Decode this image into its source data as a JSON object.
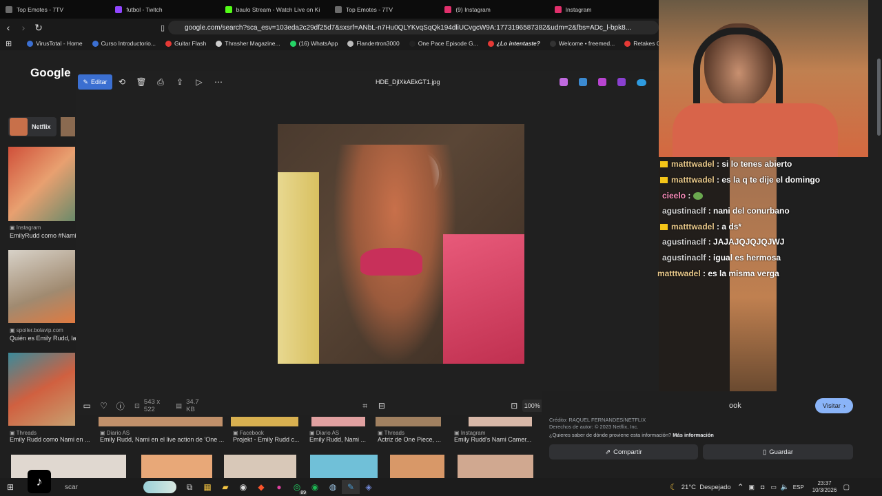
{
  "tabs": [
    {
      "label": "Top Emotes - 7TV",
      "color": "#6b6b6b"
    },
    {
      "label": "futbol - Twitch",
      "color": "#9146ff"
    },
    {
      "label": "baulo Stream - Watch Live on Ki",
      "color": "#53fc18"
    },
    {
      "label": "Top Emotes - 7TV",
      "color": "#6b6b6b"
    },
    {
      "label": "(9) Instagram",
      "color": "#e1306c"
    },
    {
      "label": "Instagram",
      "color": "#e1306c"
    }
  ],
  "omnibox": {
    "url": "google.com/search?sca_esv=103eda2c29df25d7&sxsrf=ANbL-n7Hu0QLYKvqSqQk194dliUCvgcW9A:1773196587382&udm=2&fbs=ADc_l-bpk8..."
  },
  "bookmarks": [
    {
      "label": "VirusTotal - Home",
      "color": "#3b6fd1"
    },
    {
      "label": "Curso Introductorio...",
      "color": "#3b6fd1"
    },
    {
      "label": "Guitar Flash",
      "color": "#e53935"
    },
    {
      "label": "Thrasher Magazine...",
      "color": "#cccccc"
    },
    {
      "label": "(16) WhatsApp",
      "color": "#25d366"
    },
    {
      "label": "Flandertron3000",
      "color": "#bbbbbb"
    },
    {
      "label": "One Pace Episode G...",
      "color": "#222222"
    },
    {
      "label": "¿Lo intentaste?",
      "color": "#e53935"
    },
    {
      "label": "Welcome • freemed...",
      "color": "#333333"
    },
    {
      "label": "Retakes CS",
      "color": "#e53935"
    }
  ],
  "google": {
    "logo": "Google"
  },
  "viewer": {
    "edit_label": "Editar",
    "filename": "HDE_DjlXkAEkGT1.jpg",
    "dimensions": "543 x 522",
    "filesize": "34.7 KB",
    "zoom": "100%"
  },
  "left_results": [
    {
      "chip": "Netflix"
    },
    {
      "source": "Instagram",
      "title": "EmilyRudd como #Nami..."
    },
    {
      "source": "spoiler.bolavip.com",
      "title": "Quién es Emily Rudd, la"
    }
  ],
  "bottom_results": [
    {
      "source": "Threads",
      "title": "Emily Rudd como Nami en ..."
    },
    {
      "source": "Diario AS",
      "title": "Emily Rudd, Nami en el live action de 'One ..."
    },
    {
      "source": "Facebook",
      "title": "Projekt - Emily Rudd c..."
    },
    {
      "source": "Diario AS",
      "title": "Emily Rudd, Nami ..."
    },
    {
      "source": "Threads",
      "title": "Actriz de One Piece, ..."
    },
    {
      "source": "Instagram",
      "title": "Emily Rudd's Nami Camer..."
    }
  ],
  "chat": [
    {
      "user": "matttwadel",
      "msg": "si lo tenes abierto",
      "crown": true,
      "color": "#e8c88a"
    },
    {
      "user": "matttwadel",
      "msg": "es la q te dije el domingo",
      "crown": true,
      "color": "#e8c88a"
    },
    {
      "user": "cieelo",
      "msg": "",
      "crown": false,
      "color": "#ff8fbf",
      "emote": true
    },
    {
      "user": "agustinaclf",
      "msg": "nani del conurbano",
      "crown": false,
      "color": "#cfcfcf"
    },
    {
      "user": "matttwadel",
      "msg": "a ds*",
      "crown": true,
      "color": "#e8c88a"
    },
    {
      "user": "agustinaclf",
      "msg": "JAJAJQJQJQJWJ",
      "crown": false,
      "color": "#cfcfcf"
    },
    {
      "user": "agustinaclf",
      "msg": "igual es hermosa",
      "crown": false,
      "color": "#cfcfcf"
    },
    {
      "user": "matttwadel",
      "msg": "es la misma verga",
      "crown": false,
      "color": "#e8c88a"
    }
  ],
  "right_panel": {
    "source_partial": "ook",
    "visit_label": "Visitar",
    "credit": "Crédito: RAQUEL FERNANDES/NETFLIX",
    "copyright": "Derechos de autor: © 2023 Netflix, Inc.",
    "question": "¿Quieres saber de dónde proviene esta información?",
    "more_info": "Más información",
    "share_label": "Compartir",
    "save_label": "Guardar"
  },
  "taskbar": {
    "search_placeholder": "scar",
    "whatsapp_badge": "89",
    "weather": "21°C  Despejado",
    "lang": "ESP",
    "time": "23:37",
    "date": "10/3/2026"
  }
}
